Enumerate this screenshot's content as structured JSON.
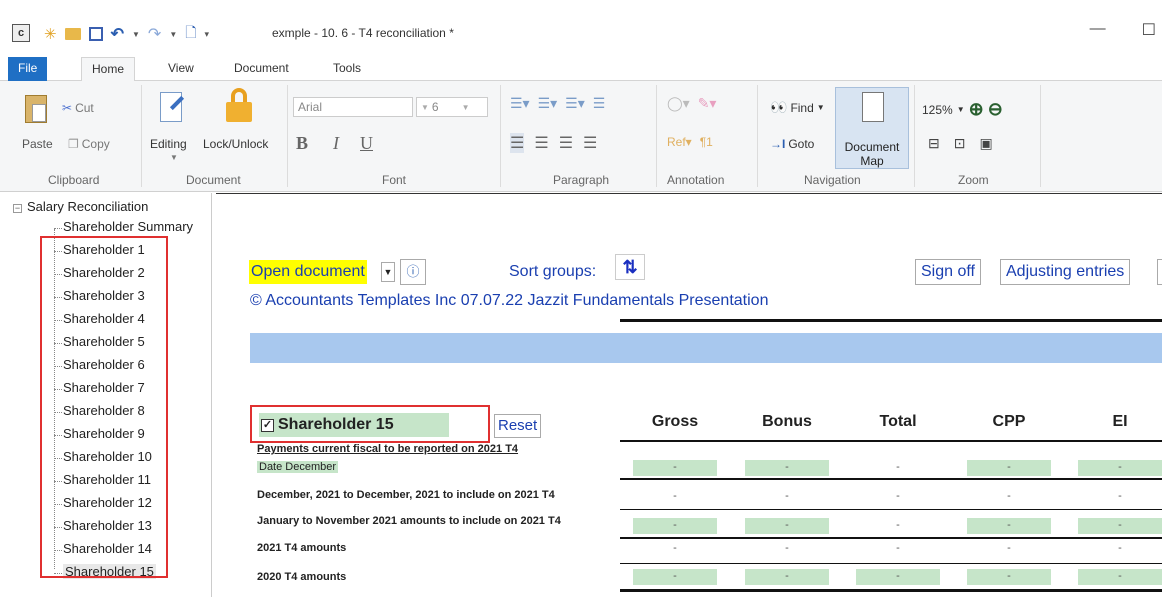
{
  "title_bar": {
    "document_title": "exmple - 10. 6 - T4 reconciliation *",
    "minimize": "—",
    "maximize": "☐"
  },
  "tabs": [
    "File",
    "Home",
    "View",
    "Document",
    "Tools"
  ],
  "ribbon": {
    "clipboard": {
      "paste": "Paste",
      "cut": "Cut",
      "copy": "Copy",
      "label": "Clipboard"
    },
    "document": {
      "editing": "Editing",
      "lock": "Lock/Unlock",
      "label": "Document"
    },
    "font": {
      "name": "Arial",
      "size": "6",
      "bold": "B",
      "italic": "I",
      "underline": "U",
      "label": "Font"
    },
    "paragraph": {
      "label": "Paragraph"
    },
    "annotation": {
      "label": "Annotation"
    },
    "navigation": {
      "find": "Find",
      "goto": "Goto",
      "docmap1": "Document",
      "docmap2": "Map",
      "label": "Navigation"
    },
    "zoom": {
      "level": "125%",
      "label": "Zoom"
    }
  },
  "tree": {
    "root": "Salary Reconciliation",
    "items": [
      "Shareholder Summary",
      "Shareholder 1",
      "Shareholder 2",
      "Shareholder 3",
      "Shareholder 4",
      "Shareholder 5",
      "Shareholder 6",
      "Shareholder 7",
      "Shareholder 8",
      "Shareholder 9",
      "Shareholder 10",
      "Shareholder 11",
      "Shareholder 12",
      "Shareholder 13",
      "Shareholder 14",
      "Shareholder 15"
    ]
  },
  "main": {
    "open_document": "Open document",
    "sort_groups": "Sort groups:",
    "sign_off": "Sign off",
    "adjusting_entries": "Adjusting entries",
    "copyright": "© Accountants Templates Inc 07.07.22  Jazzit Fundamentals Presentation",
    "shareholder": "Shareholder 15",
    "reset": "Reset",
    "columns": [
      "Gross",
      "Bonus",
      "Total",
      "CPP",
      "EI"
    ],
    "section_title": "Payments current fiscal to be reported on 2021 T4",
    "rows": [
      {
        "label": "Date December",
        "cells": [
          "-",
          "-",
          "-",
          "-",
          "-"
        ]
      },
      {
        "label": "December, 2021 to December, 2021 to include on 2021 T4",
        "cells": [
          "-",
          "-",
          "-",
          "-",
          "-"
        ]
      },
      {
        "label": "January to November 2021 amounts to include on 2021 T4",
        "cells": [
          "-",
          "-",
          "-",
          "-",
          "-"
        ]
      },
      {
        "label": "2021 T4 amounts",
        "cells": [
          "-",
          "-",
          "-",
          "-",
          "-"
        ]
      },
      {
        "label": "2020 T4 amounts",
        "cells": [
          "-",
          "-",
          "-",
          "-",
          "-"
        ]
      }
    ]
  },
  "colors": {
    "file_tab": "#1f6fc4",
    "highlight_green": "#c6e5c9",
    "blue_band": "#a8c8ee",
    "red_box": "#e03030",
    "link_blue": "#1a3fb0"
  }
}
